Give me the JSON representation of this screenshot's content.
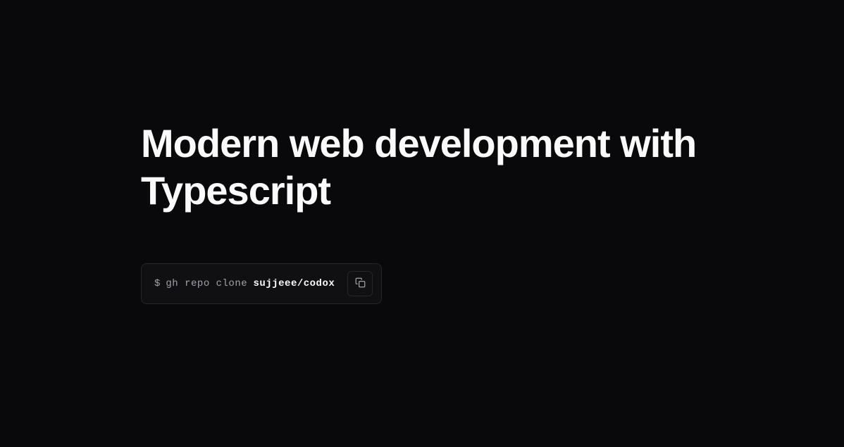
{
  "hero": {
    "heading": "Modern web development with Typescript"
  },
  "command": {
    "prompt": "$",
    "base": "gh repo clone",
    "target": "sujjeee/codox"
  }
}
